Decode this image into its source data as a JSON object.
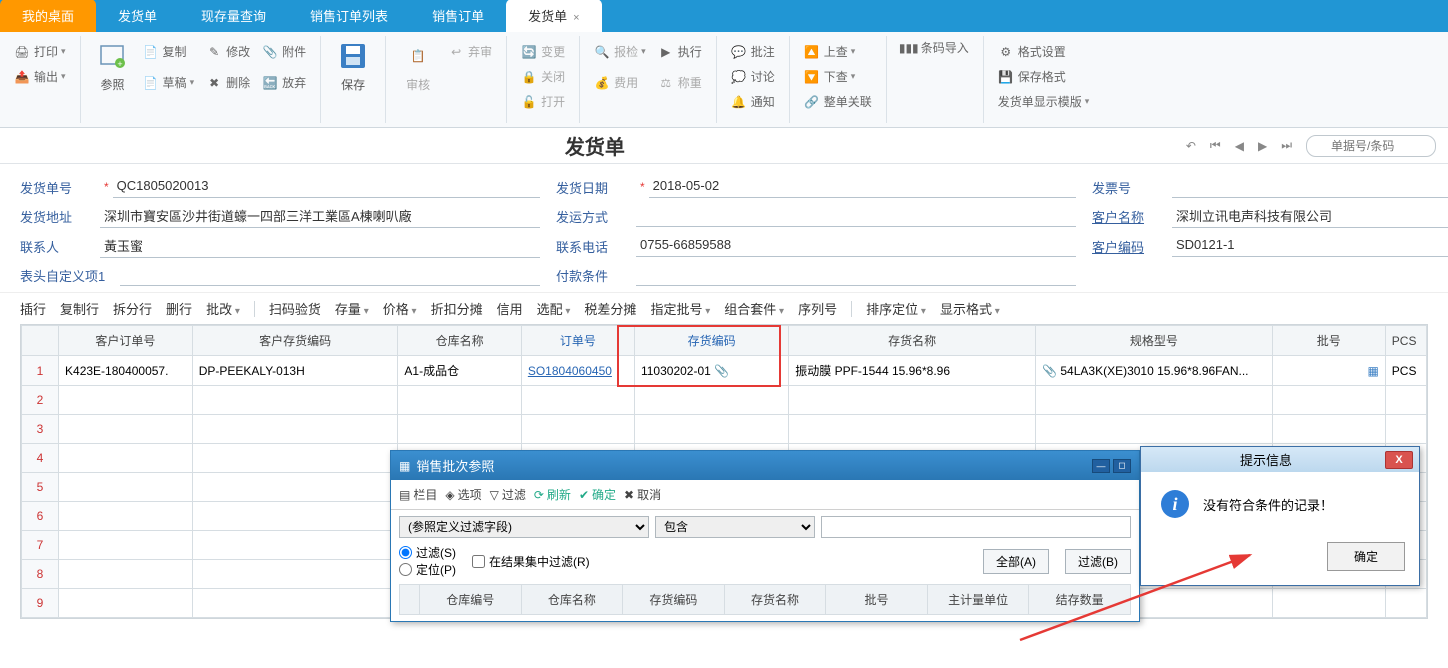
{
  "tabs": {
    "home": "我的桌面",
    "t1": "发货单",
    "t2": "现存量查询",
    "t3": "销售订单列表",
    "t4": "销售订单",
    "active": "发货单"
  },
  "ribbon": {
    "print": "打印",
    "export": "输出",
    "reference": "参照",
    "copy": "复制",
    "draft": "草稿",
    "modify": "修改",
    "delete": "删除",
    "attach": "附件",
    "discard": "放弃",
    "save": "保存",
    "audit": "审核",
    "abandon": "弃审",
    "change": "变更",
    "close": "关闭",
    "open": "打开",
    "inspect": "报检",
    "cost": "费用",
    "execute": "执行",
    "weigh": "称重",
    "approve": "批注",
    "discuss": "讨论",
    "notify": "通知",
    "lookup": "上查",
    "lookdown": "下查",
    "adjust": "整单关联",
    "barcode": "条码导入",
    "format": "格式设置",
    "saveformat": "保存格式",
    "template": "发货单显示模版"
  },
  "title": "发货单",
  "search_ph": "单据号/条码",
  "form": {
    "no_label": "发货单号",
    "no": "QC1805020013",
    "date_label": "发货日期",
    "date": "2018-05-02",
    "invoice_label": "发票号",
    "invoice": "",
    "addr_label": "发货地址",
    "addr": "深圳市寶安區沙井街道蠔一四部三洋工業區A棟喇叭廠",
    "ship_label": "发运方式",
    "ship": "",
    "cust_label": "客户名称",
    "cust": "深圳立讯电声科技有限公司",
    "contact_label": "联系人",
    "contact": "黃玉蜜",
    "tel_label": "联系电话",
    "tel": "0755-66859588",
    "code_label": "客户编码",
    "code": "SD0121-1",
    "custom_label": "表头自定义项1",
    "custom": "",
    "pay_label": "付款条件",
    "pay": ""
  },
  "tbbar": {
    "insert": "插行",
    "copyrow": "复制行",
    "splitrow": "拆分行",
    "delrow": "删行",
    "batch": "批改",
    "scan": "扫码验货",
    "stock": "存量",
    "price": "价格",
    "discount": "折扣分摊",
    "credit": "信用",
    "pick": "选配",
    "tax": "税差分摊",
    "lot": "指定批号",
    "combo": "组合套件",
    "serial": "序列号",
    "sort": "排序定位",
    "display": "显示格式"
  },
  "cols": {
    "c0": "",
    "c1": "客户订单号",
    "c2": "客户存货编码",
    "c3": "仓库名称",
    "c4": "订单号",
    "c5": "存货编码",
    "c6": "存货名称",
    "c7": "规格型号",
    "c8": "批号",
    "c9": "PCS"
  },
  "rows": [
    {
      "n": "1",
      "c1": "K423E-180400057.",
      "c2": "DP-PEEKALY-013H",
      "c3": "A1-成品仓",
      "c4": "SO1804060450",
      "c5": "11030202-01",
      "c6": "振动膜 PPF-1544 15.96*8.96",
      "c7": "54LA3K(XE)3010 15.96*8.96FAN...",
      "c8": "",
      "c9": "PCS"
    },
    {
      "n": "2"
    },
    {
      "n": "3"
    },
    {
      "n": "4"
    },
    {
      "n": "5"
    },
    {
      "n": "6"
    },
    {
      "n": "7"
    },
    {
      "n": "8"
    },
    {
      "n": "9"
    }
  ],
  "modal": {
    "title": "销售批次参照",
    "columns": "栏目",
    "options": "选项",
    "filter": "过滤",
    "refresh": "刷新",
    "ok": "确定",
    "cancel": "取消",
    "filterfield_ph": "(参照定义过滤字段)",
    "contain": "包含",
    "rfilter": "过滤(S)",
    "rinresult": "在结果集中过滤(R)",
    "rlocate": "定位(P)",
    "all": "全部(A)",
    "dofilter": "过滤(B)",
    "mc1": "仓库编号",
    "mc2": "仓库名称",
    "mc3": "存货编码",
    "mc4": "存货名称",
    "mc5": "批号",
    "mc6": "主计量单位",
    "mc7": "结存数量"
  },
  "alert": {
    "title": "提示信息",
    "msg": "没有符合条件的记录！",
    "ok": "确定"
  }
}
